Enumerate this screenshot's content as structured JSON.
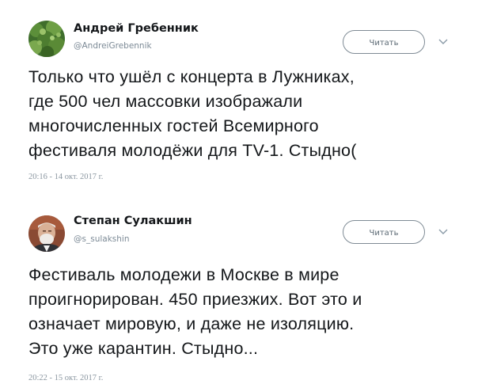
{
  "tweets": [
    {
      "name": "Андрей Гребенник",
      "handle": "@AndreiGrebennik",
      "follow_label": "Читать",
      "text": "Только что ушёл с концерта в Лужниках,\nгде 500 чел массовки изображали\nмногочисленных гостей Всемирного\nфестиваля молодёжи для TV-1. Стыдно(",
      "timestamp": "20:16 - 14 окт. 2017 г.",
      "avatar_icon": "plant-photo-avatar",
      "caret_icon": "chevron-down-icon"
    },
    {
      "name": "Степан Сулакшин",
      "handle": "@s_sulakshin",
      "follow_label": "Читать",
      "text": "Фестиваль молодежи в Москве в мире\nпроигнорирован. 450 приезжих. Вот это и\nозначает мировую, и даже не изоляцию.\nЭто уже карантин. Стыдно...",
      "timestamp": "20:22 - 15 окт. 2017 г.",
      "avatar_icon": "person-photo-avatar",
      "caret_icon": "chevron-down-icon"
    }
  ],
  "colors": {
    "text": "#14171a",
    "secondary": "#7c8a96",
    "button_border": "#7f8b95"
  }
}
